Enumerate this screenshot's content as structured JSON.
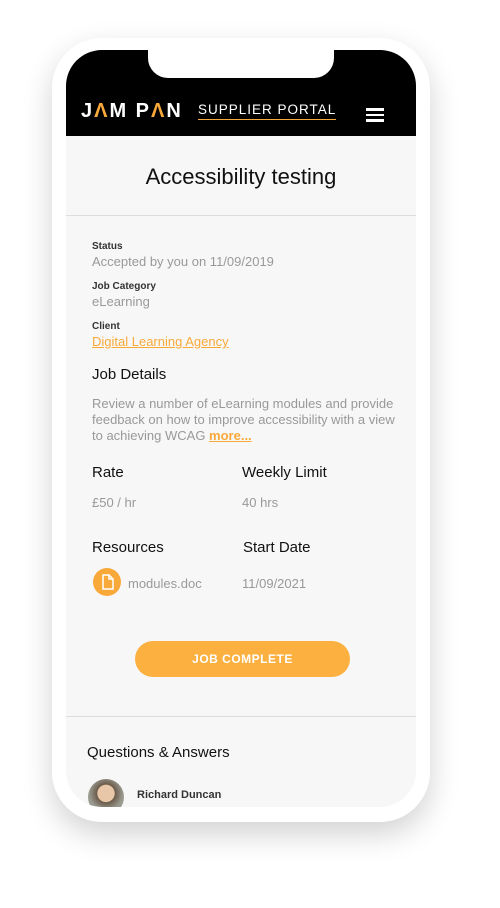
{
  "header": {
    "logo_j": "J",
    "logo_a1": "Λ",
    "logo_m": "M P",
    "logo_a2": "Λ",
    "logo_n": "N",
    "logo_text": "JAM PAN",
    "portal": "SUPPLIER PORTAL"
  },
  "title": "Accessibility testing",
  "status": {
    "label": "Status",
    "value": "Accepted by you on 11/09/2019"
  },
  "category": {
    "label": "Job Category",
    "value": "eLearning"
  },
  "client": {
    "label": "Client",
    "value": "Digital Learning Agency"
  },
  "details": {
    "heading": "Job Details",
    "text": "Review a number of eLearning modules and provide feedback on how to improve accessibility with a view to achieving WCAG ",
    "more": "more..."
  },
  "rate": {
    "label": "Rate",
    "value": "£50 / hr"
  },
  "limit": {
    "label": "Weekly Limit",
    "value": "40 hrs"
  },
  "resources": {
    "label": "Resources",
    "file": "modules.doc"
  },
  "start": {
    "label": "Start Date",
    "value": "11/09/2021"
  },
  "button": "JOB COMPLETE",
  "qa": {
    "heading": "Questions & Answers",
    "user": "Richard Duncan"
  },
  "colors": {
    "accent": "#f9a93a"
  }
}
